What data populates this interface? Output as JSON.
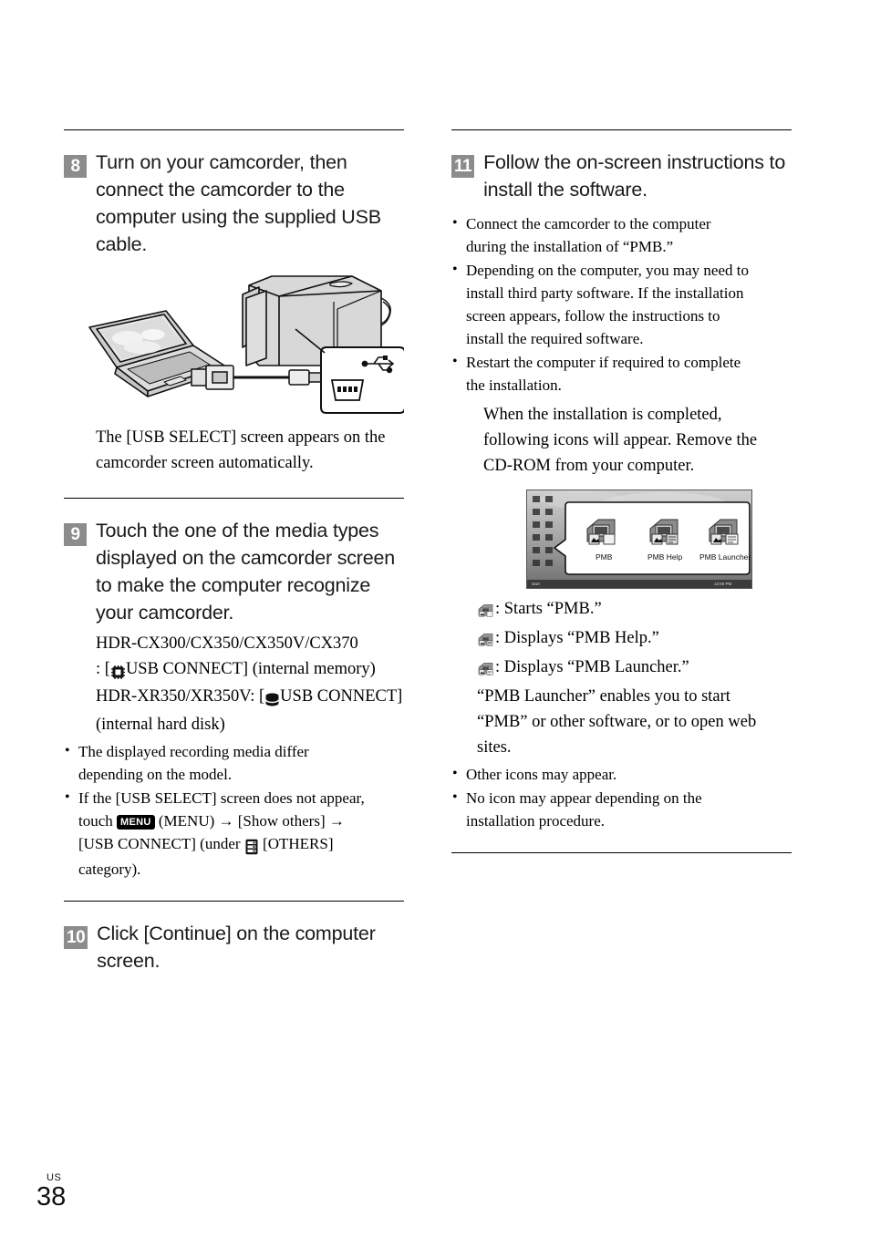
{
  "page": {
    "region_label": "US",
    "page_number": "38"
  },
  "left_column": {
    "step8": {
      "badge": "8",
      "title": "Turn on your camcorder, then connect the camcorder to the computer using the supplied USB cable.",
      "illustration_name": "camcorder-to-computer-usb-connection",
      "caption": "The [USB SELECT] screen appears on the camcorder screen automatically."
    },
    "step9": {
      "badge": "9",
      "title": "Touch the one of the media types displayed on the camcorder screen to make the computer recognize your camcorder.",
      "line1_models": "HDR-CX300/CX350/CX350V/CX370",
      "line1_rest_before_icon": ": [",
      "line1_icon": "internal-memory-icon",
      "line1_after_icon": "USB CONNECT] (internal memory)",
      "line2_models": "HDR-XR350/XR350V: [",
      "line2_icon": "internal-hard-disk-icon",
      "line2_after_icon": "USB CONNECT] (internal hard disk)",
      "bullets": [
        "The displayed recording media differ depending on the model."
      ],
      "bullet2": {
        "part1": "If the [USB SELECT] screen does not appear, touch ",
        "menu_icon_label": "MENU",
        "part2": " (MENU) ",
        "arrow1": "→",
        "part3": " [Show others] ",
        "arrow2": "→",
        "part4": " [USB CONNECT] (under ",
        "others_icon": "others-category-icon",
        "part5": " [OTHERS] category)."
      }
    },
    "step10": {
      "badge": "10",
      "title": "Click [Continue] on the computer screen."
    }
  },
  "right_column": {
    "step11": {
      "badge": "11",
      "title": "Follow the on-screen instructions to install the software.",
      "bullets": [
        "Connect the camcorder to the computer during the installation of “PMB.”",
        "Depending on the computer, you may need to install third party software. If the installation screen appears, follow the instructions to install the required software.",
        "Restart the computer if required to complete the installation."
      ],
      "paragraph": "When the installation is completed, following icons will appear. Remove the CD-ROM from your computer.",
      "screenshot": {
        "name": "pmb-desktop-icons-screenshot",
        "icon_labels": [
          "PMB",
          "PMB Help",
          "PMB Launcher"
        ]
      },
      "legend": [
        {
          "icon": "pmb-icon",
          "text": ": Starts “PMB.”"
        },
        {
          "icon": "pmb-help-icon",
          "text": ": Displays “PMB Help.”"
        },
        {
          "icon": "pmb-launcher-icon",
          "text": ": Displays “PMB Launcher.”"
        }
      ],
      "launcher_paragraph": "“PMB Launcher” enables you to start “PMB” or other software, or to open web sites.",
      "tail_bullets": [
        "Other icons may appear.",
        "No icon may appear depending on the installation procedure."
      ]
    }
  },
  "colors": {
    "badge_bg": "#8c8c8c",
    "rule": "#000000",
    "illustration_fill": "#d6d6d6",
    "menu_icon_bg": "#000000"
  }
}
